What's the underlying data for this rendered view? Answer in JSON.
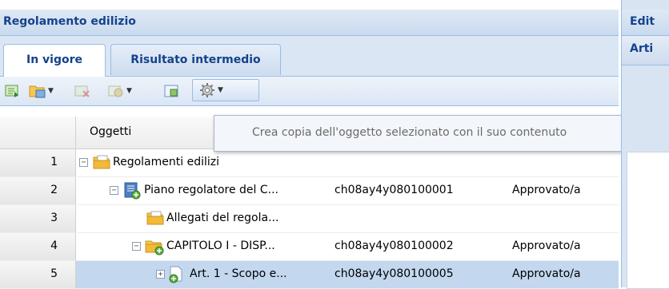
{
  "panel": {
    "title": "Regolamento edilizio"
  },
  "tabs": [
    {
      "label": "In vigore",
      "active": true
    },
    {
      "label": "Risultato intermedio",
      "active": false
    }
  ],
  "toolbar": {
    "buttons": [
      {
        "icon": "refresh-tree-icon",
        "dropdown": false
      },
      {
        "icon": "folder-tree-icon",
        "dropdown": true
      },
      {
        "icon": "delete-object-icon",
        "dropdown": false
      },
      {
        "icon": "object-settings-icon",
        "dropdown": true
      },
      {
        "icon": "export-icon",
        "dropdown": false
      },
      {
        "icon": "gear-icon",
        "dropdown": true
      }
    ]
  },
  "tooltip": {
    "text": "Crea copia dell'oggetto selezionato con il suo contenuto"
  },
  "grid": {
    "columns": {
      "objects": "Oggetti"
    },
    "rows": [
      {
        "num": "1",
        "name": "Regolamenti edilizi",
        "code": "",
        "status": "",
        "icon": "folder-icon",
        "toggle": "−",
        "selected": false
      },
      {
        "num": "2",
        "name": "Piano regolatore del C...",
        "code": "ch08ay4y080100001",
        "status": "Approvato/a",
        "icon": "document-plan-icon",
        "toggle": "−",
        "selected": false
      },
      {
        "num": "3",
        "name": "Allegati del regola...",
        "code": "",
        "status": "",
        "icon": "folder-icon",
        "toggle": "",
        "selected": false
      },
      {
        "num": "4",
        "name": "CAPITOLO I - DISP...",
        "code": "ch08ay4y080100002",
        "status": "Approvato/a",
        "icon": "folder-add-icon",
        "toggle": "−",
        "selected": false
      },
      {
        "num": "5",
        "name": "Art. 1 - Scopo e...",
        "code": "ch08ay4y080100005",
        "status": "Approvato/a",
        "icon": "document-add-icon",
        "toggle": "+",
        "selected": true
      }
    ]
  },
  "right_panel": {
    "title": "Edit",
    "subtitle": "Arti"
  },
  "colors": {
    "header_text": "#15428b",
    "selection": "#c3d7ef",
    "border": "#99bbe8"
  }
}
